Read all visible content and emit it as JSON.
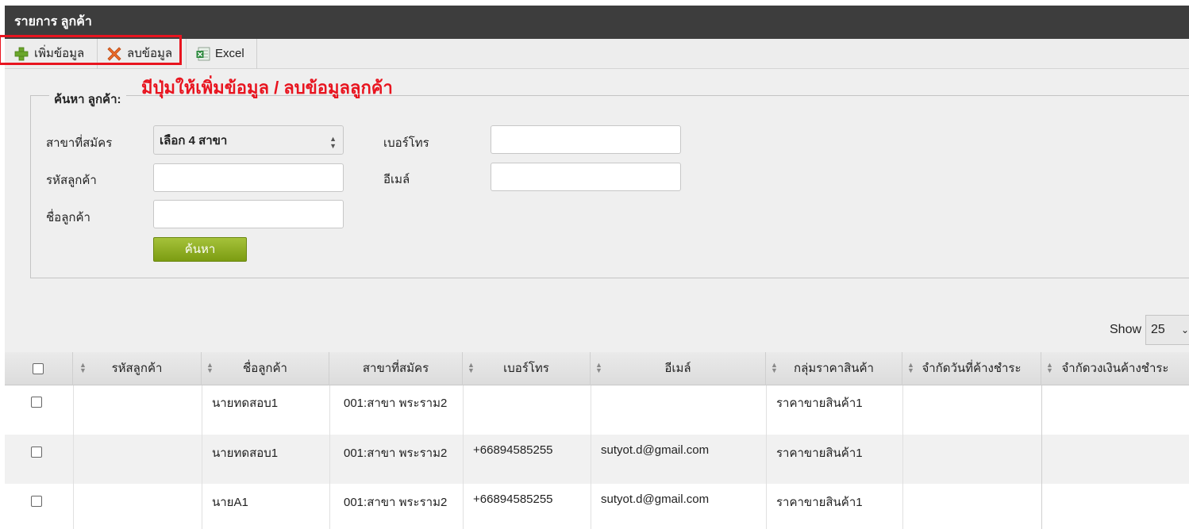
{
  "window": {
    "title": "รายการ ลูกค้า"
  },
  "toolbar": {
    "add_label": "เพิ่มข้อมูล",
    "delete_label": "ลบข้อมูล",
    "excel_label": "Excel"
  },
  "annotation": {
    "text": "มีปุ่มให้เพิ่มข้อมูล / ลบข้อมูลลูกค้า",
    "color": "#e8141f"
  },
  "search": {
    "legend": "ค้นหา ลูกค้า:",
    "branch_label": "สาขาที่สมัคร",
    "branch_value": "เลือก 4 สาขา",
    "phone_label": "เบอร์โทร",
    "code_label": "รหัสลูกค้า",
    "email_label": "อีเมล์",
    "name_label": "ชื่อลูกค้า",
    "button": "ค้นหา",
    "button_color": "#8fb023"
  },
  "show": {
    "label": "Show",
    "value": "25"
  },
  "table": {
    "columns": [
      "รหัสลูกค้า",
      "ชื่อลูกค้า",
      "สาขาที่สมัคร",
      "เบอร์โทร",
      "อีเมล์",
      "กลุ่มราคาสินค้า",
      "จำกัดวันที่ค้างชำระ",
      "จำกัดวงเงินค้างชำระ"
    ],
    "rows": [
      {
        "code": "",
        "name": "นายทดสอบ1",
        "branch": "001:สาขา พระราม2",
        "phone": "",
        "email": "",
        "price_group": "ราคาขายสินค้า1",
        "due_days": "",
        "credit": ""
      },
      {
        "code": "",
        "name": "นายทดสอบ1",
        "branch": "001:สาขา พระราม2",
        "phone": "+66894585255",
        "email": "sutyot.d@gmail.com",
        "price_group": "ราคาขายสินค้า1",
        "due_days": "",
        "credit": ""
      },
      {
        "code": "",
        "name": "นายA1",
        "branch": "001:สาขา พระราม2",
        "phone": "+66894585255",
        "email": "sutyot.d@gmail.com",
        "price_group": "ราคาขายสินค้า1",
        "due_days": "",
        "credit": ""
      }
    ]
  }
}
